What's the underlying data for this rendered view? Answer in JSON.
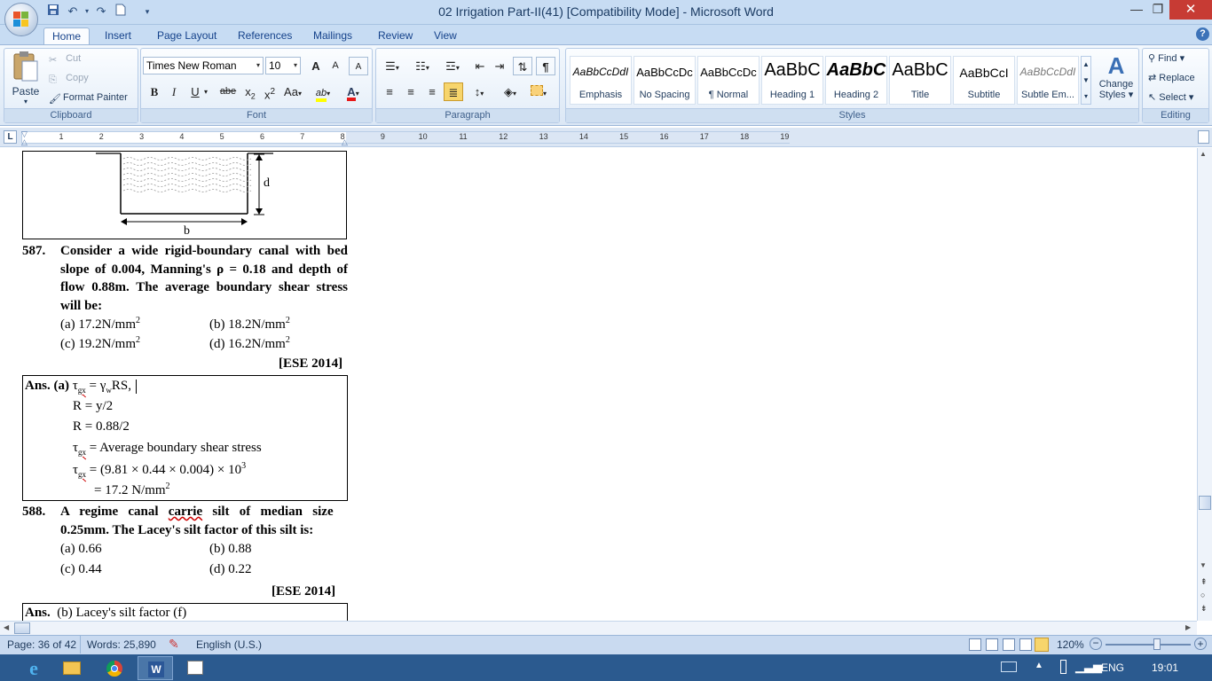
{
  "window": {
    "title": "02 Irrigation Part-II(41) [Compatibility Mode] - Microsoft Word",
    "minimize_icon": "minimize-icon",
    "restore_icon": "restore-icon",
    "close_icon": "close-icon",
    "close_glyph": "✕",
    "minimize_glyph": "—",
    "restore_glyph": "❐"
  },
  "tabs": [
    {
      "label": "Home",
      "active": true
    },
    {
      "label": "Insert"
    },
    {
      "label": "Page Layout"
    },
    {
      "label": "References"
    },
    {
      "label": "Mailings"
    },
    {
      "label": "Review"
    },
    {
      "label": "View"
    }
  ],
  "help_glyph": "?",
  "ribbon": {
    "clipboard": {
      "paste": "Paste",
      "cut": "Cut",
      "copy": "Copy",
      "format_painter": "Format Painter",
      "group_label": "Clipboard"
    },
    "font": {
      "font_name": "Times New Roman",
      "font_size": "10",
      "grow": "A",
      "shrink": "A",
      "bold": "B",
      "italic": "I",
      "underline": "U",
      "strike": "abe",
      "subscript": "x",
      "subscript_mark": "2",
      "superscript": "x",
      "superscript_mark": "2",
      "change_case": "Aa",
      "highlight": "ab",
      "font_color": "A",
      "group_label": "Font"
    },
    "paragraph": {
      "group_label": "Paragraph",
      "show_marks": "¶"
    },
    "styles": {
      "items": [
        {
          "preview": "AaBbCcDdI",
          "name": "Emphasis"
        },
        {
          "preview": "AaBbCcDc",
          "name": "No Spacing"
        },
        {
          "preview": "AaBbCcDc",
          "name": "¶ Normal"
        },
        {
          "preview": "AaBbC",
          "name": "Heading 1"
        },
        {
          "preview": "AaBbC",
          "name": "Heading 2"
        },
        {
          "preview": "AaBbC",
          "name": "Title"
        },
        {
          "preview": "AaBbCcI",
          "name": "Subtitle"
        },
        {
          "preview": "AaBbCcDdI",
          "name": "Subtle Em..."
        }
      ],
      "change_styles": "Change Styles",
      "change_styles_line1": "Change",
      "change_styles_line2": "Styles",
      "group_label": "Styles"
    },
    "editing": {
      "find": "Find",
      "replace": "Replace",
      "select": "Select",
      "group_label": "Editing"
    }
  },
  "ruler": {
    "numbers": [
      "1",
      "2",
      "3",
      "4",
      "5",
      "6",
      "7",
      "8",
      "9",
      "10",
      "11",
      "12",
      "13",
      "14",
      "15",
      "16",
      "17",
      "18",
      "19"
    ],
    "tab_selector": "L"
  },
  "document": {
    "figure": {
      "label_d": "d",
      "label_b": "b"
    },
    "q587": {
      "number": "587.",
      "text_l1": "Consider a wide rigid-boundary canal with bed",
      "text_l2": "slope of 0.004, Manning's ρ = 0.18 and depth of",
      "text_l3": "flow 0.88m. The average boundary shear stress",
      "text_l4": "will be:",
      "opt_a": "(a)   17.2N/mm",
      "opt_b": "(b)   18.2N/mm",
      "opt_c": "(c)   19.2N/mm",
      "opt_d": "(d)   16.2N/mm",
      "sq": "2",
      "source": "[ESE 2014]"
    },
    "ans587": {
      "prefix": "Ans. (a)",
      "l1_tau": "τ",
      "l1_sub": "gx",
      "l1_mid": " = γ",
      "l1_sub2": "w",
      "l1_rest": "RS,",
      "l2": "R = y/2",
      "l3": "R = 0.88/2",
      "l4_tau": "τ",
      "l4_sub": "gx",
      "l4_rest": " = Average boundary shear stress",
      "l5_tau": "τ",
      "l5_sub": "gx",
      "l5_rest": " = (9.81 × 0.44 × 0.004) × 10",
      "l5_sup": "3",
      "l6": "= 17.2 N/mm",
      "l6_sup": "2"
    },
    "q588": {
      "number": "588.",
      "text_l1a": "A   regime   canal   ",
      "text_l1b": "carrie",
      "text_l1c": "   silt   of   median   size",
      "text_l2": "0.25mm. The Lacey's silt factor of this silt is:",
      "opt_a": "(a)   0.66",
      "opt_b": "(b)   0.88",
      "opt_c": "(c)   0.44",
      "opt_d": "(d)   0.22",
      "source": "[ESE 2014]"
    },
    "ans588": {
      "prefix": "Ans.",
      "text": "(b) Lacey's silt factor (f)"
    }
  },
  "statusbar": {
    "page": "Page: 36 of 42",
    "words": "Words: 25,890",
    "language": "English (U.S.)",
    "zoom": "120%",
    "zoom_level": 0.6
  },
  "taskbar": {
    "lang": "ENG",
    "time": "19:01"
  }
}
